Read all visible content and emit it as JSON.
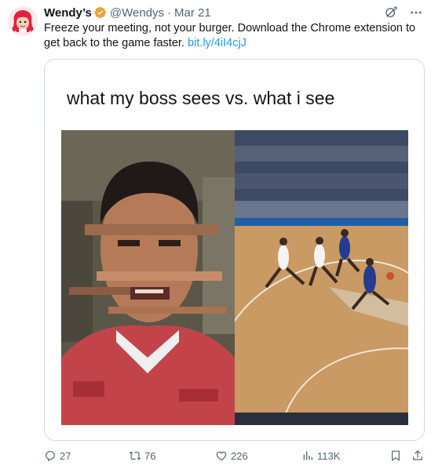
{
  "author": {
    "name": "Wendy’s",
    "handle": "@Wendys",
    "separator": "·",
    "date": "Mar 21",
    "brand_color": "#e2203d",
    "verified_color": "#e8a33b"
  },
  "tweet": {
    "text": "Freeze your meeting, not your burger. Download the Chrome extension to get back to the game faster. ",
    "link": "bit.ly/4iI4cjJ",
    "link_color": "#1d9bf0"
  },
  "media": {
    "caption": "what my boss sees vs. what i see",
    "left_panel": "glitched-face-photo",
    "right_panel": "basketball-game-photo"
  },
  "actions": {
    "replies": "27",
    "reposts": "76",
    "likes": "226",
    "views": "113K"
  },
  "icons": [
    "verified-badge-icon",
    "grok-icon",
    "more-icon",
    "reply-icon",
    "retweet-icon",
    "like-icon",
    "views-icon",
    "bookmark-icon",
    "share-icon"
  ]
}
